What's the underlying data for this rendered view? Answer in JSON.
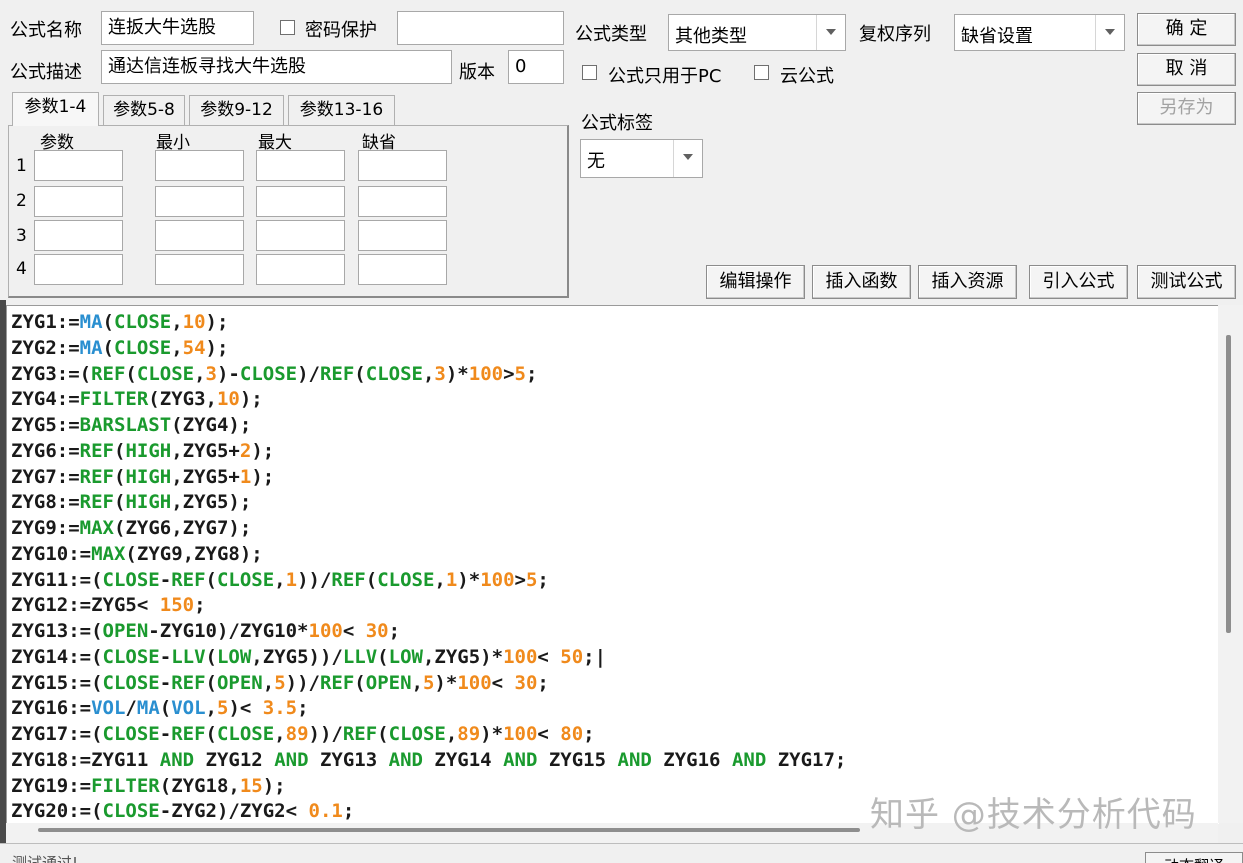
{
  "name_label": "公式名称",
  "name_value": "连扳大牛选股",
  "password_label": "密码保护",
  "password_value": "",
  "desc_label": "公式描述",
  "desc_value": "通达信连板寻找大牛选股",
  "version_label": "版本",
  "version_value": "0",
  "type_label": "公式类型",
  "type_value": "其他类型",
  "rights_label": "复权序列",
  "rights_value": "缺省设置",
  "pc_only_label": "公式只用于PC",
  "cloud_label": "云公式",
  "tag_label": "公式标签",
  "tag_value": "无",
  "buttons": {
    "ok": "确 定",
    "cancel": "取 消",
    "save_as": "另存为",
    "edit_ops": "编辑操作",
    "insert_func": "插入函数",
    "insert_res": "插入资源",
    "import_formula": "引入公式",
    "test_formula": "测试公式"
  },
  "tabs": [
    "参数1-4",
    "参数5-8",
    "参数9-12",
    "参数13-16"
  ],
  "param_headers": [
    "参数",
    "最小",
    "最大",
    "缺省"
  ],
  "param_rows": [
    "1",
    "2",
    "3",
    "4"
  ],
  "code_lines": [
    "ZYG1:=MA(CLOSE,10);",
    "ZYG2:=MA(CLOSE,54);",
    "ZYG3:=(REF(CLOSE,3)-CLOSE)/REF(CLOSE,3)*100>5;",
    "ZYG4:=FILTER(ZYG3,10);",
    "ZYG5:=BARSLAST(ZYG4);",
    "ZYG6:=REF(HIGH,ZYG5+2);",
    "ZYG7:=REF(HIGH,ZYG5+1);",
    "ZYG8:=REF(HIGH,ZYG5);",
    "ZYG9:=MAX(ZYG6,ZYG7);",
    "ZYG10:=MAX(ZYG9,ZYG8);",
    "ZYG11:=(CLOSE-REF(CLOSE,1))/REF(CLOSE,1)*100>5;",
    "ZYG12:=ZYG5< 150;",
    "ZYG13:=(OPEN-ZYG10)/ZYG10*100< 30;",
    "ZYG14:=(CLOSE-LLV(LOW,ZYG5))/LLV(LOW,ZYG5)*100< 50;|",
    "ZYG15:=(CLOSE-REF(OPEN,5))/REF(OPEN,5)*100< 30;",
    "ZYG16:=VOL/MA(VOL,5)< 3.5;",
    "ZYG17:=(CLOSE-REF(CLOSE,89))/REF(CLOSE,89)*100< 80;",
    "ZYG18:=ZYG11 AND ZYG12 AND ZYG13 AND ZYG14 AND ZYG15 AND ZYG16 AND ZYG17;",
    "ZYG19:=FILTER(ZYG18,15);",
    "ZYG20:=(CLOSE-ZYG2)/ZYG2< 0.1;"
  ],
  "syntax_colors": {
    "text": "#1a1a1a",
    "number": "#f08a1c",
    "function": "#1a9a2e",
    "variable": "#2a8fd0"
  },
  "status_text": "测试通过!",
  "status_button": "动态翻译",
  "watermark": "知乎 @技术分析代码"
}
